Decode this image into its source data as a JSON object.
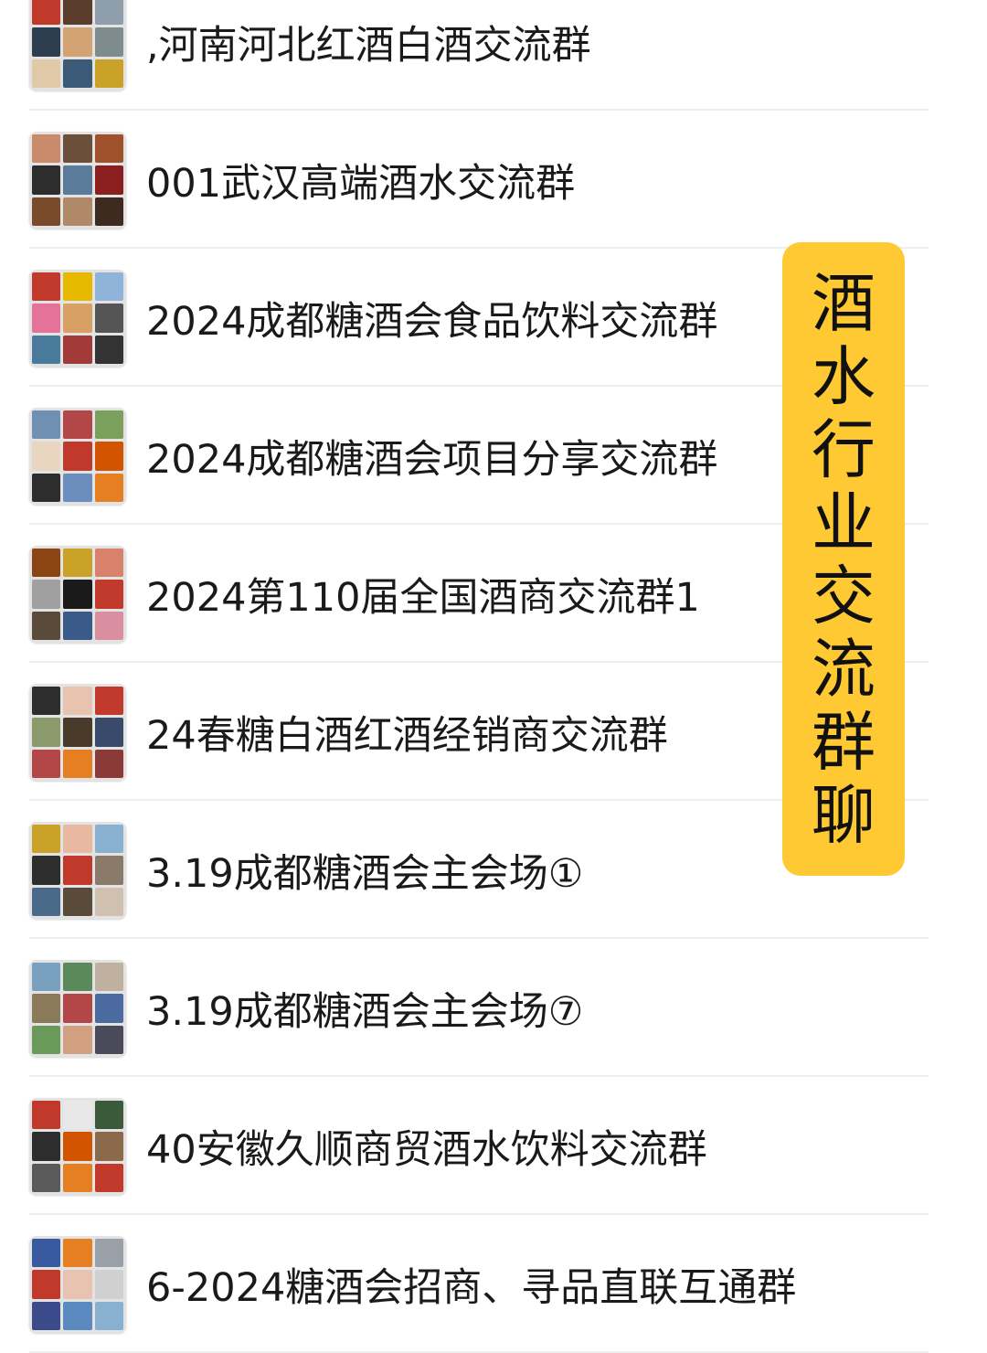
{
  "groups": [
    {
      "name": ",河南河北红酒白酒交流群",
      "tiles": [
        "#c0392b",
        "#5b3d2e",
        "#8e9eab",
        "#2c3e50",
        "#d4a373",
        "#7f8c8d",
        "#e0c9a6",
        "#3a5a78",
        "#c9a227"
      ]
    },
    {
      "name": "001武汉高端酒水交流群",
      "tiles": [
        "#c98b6b",
        "#6b4f3a",
        "#a0522d",
        "#2d2d2d",
        "#5b7b9a",
        "#8b1e1e",
        "#7a4b2a",
        "#b08968",
        "#3d2b1f"
      ]
    },
    {
      "name": "2024成都糖酒会食品饮料交流群",
      "tiles": [
        "#c0392b",
        "#e6b800",
        "#8fb3d9",
        "#e57399",
        "#d9a066",
        "#555555",
        "#4a7a9b",
        "#a33a3a",
        "#333333"
      ]
    },
    {
      "name": "2024成都糖酒会项目分享交流群",
      "tiles": [
        "#6f8fb3",
        "#b34747",
        "#7ba05b",
        "#e8d6c0",
        "#c0392b",
        "#d35400",
        "#2d2d2d",
        "#6c8ebf",
        "#e67e22"
      ]
    },
    {
      "name": "2024第110届全国酒商交流群1",
      "tiles": [
        "#8b4513",
        "#c9a227",
        "#d9826b",
        "#a0a0a0",
        "#1a1a1a",
        "#c0392b",
        "#5a4a3a",
        "#3a5a8a",
        "#d98fa0"
      ]
    },
    {
      "name": "24春糖白酒红酒经销商交流群",
      "tiles": [
        "#2d2d2d",
        "#e8c4b0",
        "#c0392b",
        "#8a9a6b",
        "#4a3a2a",
        "#3a4a6a",
        "#b34747",
        "#e67e22",
        "#8b3a3a"
      ]
    },
    {
      "name": "3.19成都糖酒会主会场①",
      "tiles": [
        "#c9a227",
        "#e8b8a0",
        "#8ab0d0",
        "#2d2d2d",
        "#c0392b",
        "#8a7a6a",
        "#4a6a8a",
        "#5a4a3a",
        "#d0c0b0"
      ]
    },
    {
      "name": "3.19成都糖酒会主会场⑦",
      "tiles": [
        "#7aa0c0",
        "#5a8a5a",
        "#c0b0a0",
        "#8a7a5a",
        "#b34747",
        "#4a6aa0",
        "#6a9a5a",
        "#d0a080",
        "#4a4a5a"
      ]
    },
    {
      "name": "40安徽久顺商贸酒水饮料交流群",
      "tiles": [
        "#c0392b",
        "#e8e8e8",
        "#3a5a3a",
        "#2d2d2d",
        "#d35400",
        "#8a6a4a",
        "#5a5a5a",
        "#e67e22",
        "#c0392b"
      ]
    },
    {
      "name": "6-2024糖酒会招商、寻品直联互通群",
      "tiles": [
        "#3a5aa0",
        "#e67e22",
        "#9aa0a8",
        "#c0392b",
        "#e8c4b0",
        "#d0d0d0",
        "#3a4a8a",
        "#5a8ac0",
        "#8ab0d0"
      ]
    }
  ],
  "banner": {
    "chars": [
      "酒",
      "水",
      "行",
      "业",
      "交",
      "流",
      "群",
      "聊"
    ],
    "color": "#ffc933"
  }
}
